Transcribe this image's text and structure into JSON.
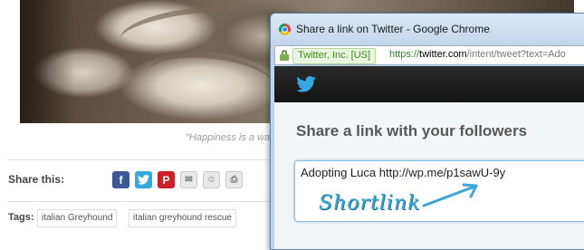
{
  "post": {
    "caption": "\"Happiness is a wa",
    "share_label": "Share this:",
    "share_buttons": [
      {
        "glyph": "f",
        "icon": "facebook-icon"
      },
      {
        "glyph": "t",
        "icon": "twitter-icon"
      },
      {
        "glyph": "P",
        "icon": "pinterest-icon"
      },
      {
        "glyph": "✉",
        "icon": "email-icon"
      },
      {
        "glyph": "☺",
        "icon": "reddit-icon"
      },
      {
        "glyph": "⎙",
        "icon": "print-icon"
      }
    ],
    "tags_label": "Tags:",
    "tags": [
      "italian Greyhound",
      "italian greyhound rescue"
    ]
  },
  "window": {
    "title": "Share a link on Twitter - Google Chrome",
    "ev_badge": "Twitter, Inc. [US]",
    "url_scheme": "https://",
    "url_host": "twitter.com",
    "url_path": "/intent/tweet?text=Ado"
  },
  "twitter": {
    "heading": "Share a link with your followers",
    "tweet_text": "Adopting Luca http://wp.me/p1sawU-9y",
    "annotation": "Shortlink"
  },
  "colors": {
    "twitter_blue": "#33a9dd",
    "facebook_blue": "#3b5998",
    "pinterest_red": "#cb2027",
    "ev_green": "#3b8b1f"
  }
}
